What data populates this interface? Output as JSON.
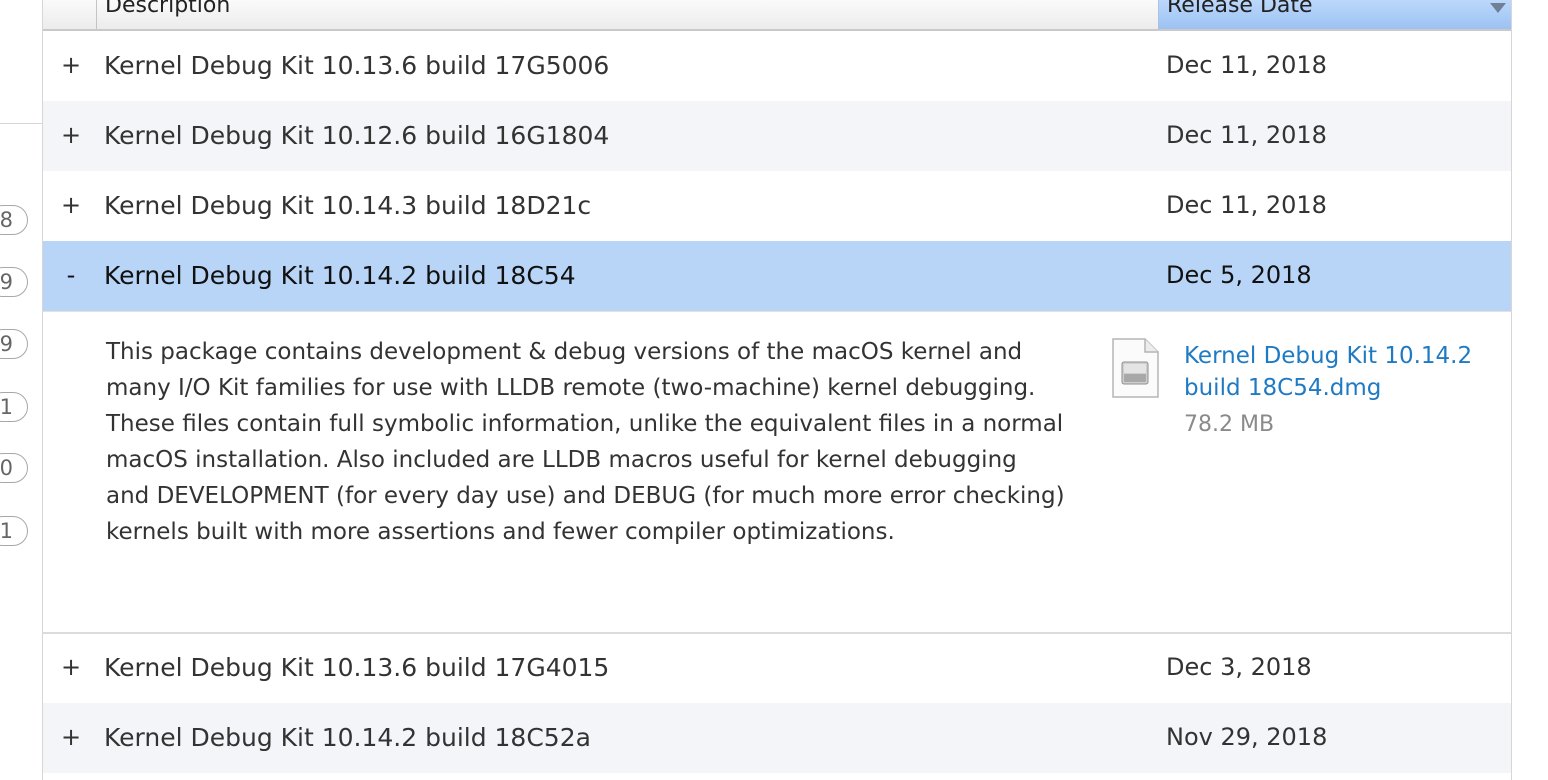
{
  "sidebar": {
    "badges": [
      "8",
      "9",
      "9",
      "1",
      "0",
      "1"
    ]
  },
  "header": {
    "description_label": "Description",
    "date_label": "Release Date"
  },
  "rows": [
    {
      "toggle": "+",
      "description": "Kernel Debug Kit 10.13.6 build 17G5006",
      "date": "Dec 11, 2018"
    },
    {
      "toggle": "+",
      "description": "Kernel Debug Kit 10.12.6 build 16G1804",
      "date": "Dec 11, 2018"
    },
    {
      "toggle": "+",
      "description": "Kernel Debug Kit 10.14.3 build 18D21c",
      "date": "Dec 11, 2018"
    },
    {
      "toggle": "-",
      "description": "Kernel Debug Kit 10.14.2 build 18C54",
      "date": "Dec 5, 2018",
      "selected": true
    },
    {
      "toggle": "+",
      "description": "Kernel Debug Kit 10.13.6 build 17G4015",
      "date": "Dec 3, 2018"
    },
    {
      "toggle": "+",
      "description": "Kernel Debug Kit 10.14.2 build 18C52a",
      "date": "Nov 29, 2018"
    }
  ],
  "detail": {
    "text": "This package contains development & debug versions of the macOS kernel and many I/O Kit families for use with LLDB remote (two-machine) kernel debugging. These files contain full symbolic information, unlike the equivalent files in a normal macOS installation. Also included are LLDB macros useful for kernel debugging and DEVELOPMENT (for every day use) and DEBUG (for much more error checking) kernels built with more assertions and fewer compiler optimizations.",
    "file_icon": "disk-image-file-icon",
    "file_name": "Kernel Debug Kit 10.14.2 build 18C54.dmg",
    "file_size": "78.2 MB"
  },
  "colors": {
    "selected_row": "#b8d5f8",
    "alt_row": "#f3f5f9",
    "link": "#1f7ac4",
    "header_sorted": "#9cc2f3"
  }
}
